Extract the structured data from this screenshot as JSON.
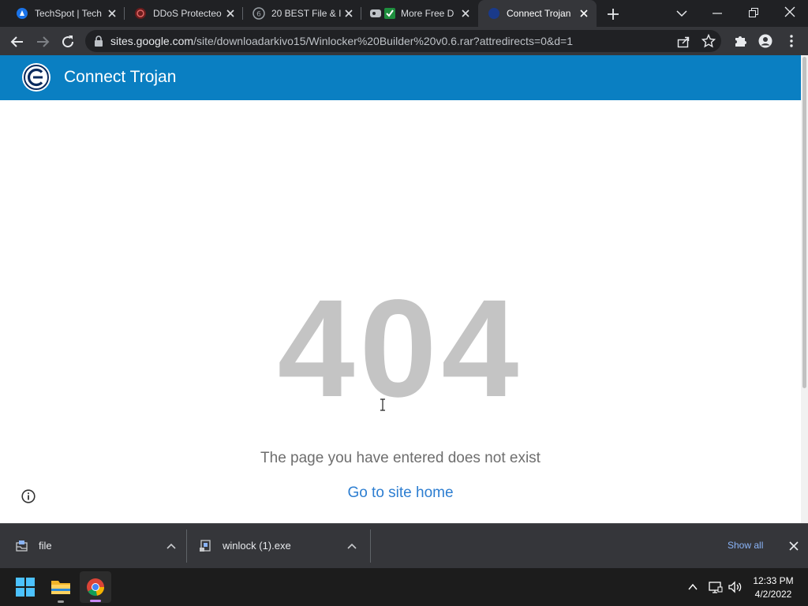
{
  "tabs": [
    {
      "title": "TechSpot | Tech",
      "icon": "techspot-icon"
    },
    {
      "title": "DDoS Protecteo",
      "icon": "shield-icon"
    },
    {
      "title": "20 BEST File & I",
      "icon": "globe-icon"
    },
    {
      "title": "More Free D",
      "icon": "check-icon"
    },
    {
      "title": "Connect Trojan",
      "icon": "site-icon"
    }
  ],
  "address": {
    "domain": "sites.google.com",
    "path": "/site/downloadarkivo15/Winlocker%20Builder%20v0.6.rar?attredirects=0&d=1"
  },
  "site": {
    "title": "Connect Trojan"
  },
  "error": {
    "code": "404",
    "message": "The page you have entered does not exist",
    "home_link": "Go to site home"
  },
  "downloads": [
    {
      "name": "file"
    },
    {
      "name": "winlock (1).exe"
    }
  ],
  "shelf": {
    "show_all": "Show all"
  },
  "clock": {
    "time": "12:33 PM",
    "date": "4/2/2022"
  },
  "colors": {
    "site_header": "#0a7fc2",
    "link": "#2d7ed1",
    "code_gray": "#c4c4c4"
  }
}
